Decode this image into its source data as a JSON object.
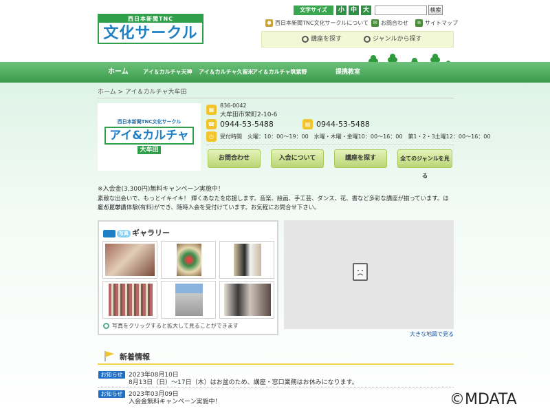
{
  "header": {
    "logo_top": "西日本新聞TNC",
    "logo_main": "文化サークル",
    "font_size_label": "文字サイズ",
    "font_sizes": [
      "小",
      "中",
      "大"
    ],
    "search_placeholder": "",
    "search_button": "検索",
    "top_links": [
      "西日本新聞TNC文化サークルについて",
      "お問合わせ",
      "サイトマップ"
    ],
    "search_course": "講座を探す",
    "search_genre": "ジャンルから探す"
  },
  "nav": [
    "ホーム",
    "アイ＆カルチャ天神",
    "アイ＆カルチャ久留米",
    "アイ＆カルチャ筑紫野",
    "提携教室"
  ],
  "breadcrumb": "ホーム > アイ＆カルチャ大牟田",
  "shop": {
    "logo_sub": "西日本新聞TNC文化サークル",
    "logo_name": "アイ&カルチャ",
    "logo_place": "大牟田",
    "postal": "836-0042",
    "address": "大牟田市栄町2-10-6",
    "tel": "0944-53-5488",
    "fax": "0944-53-5488",
    "hours": "受付時間　火曜：10：00～19：00　水曜・木曜・金曜10：00～16：00　第1・2・3土曜12：00～16：00"
  },
  "actions": [
    "お問合わせ",
    "入会について",
    "講座を探す",
    "全てのジャンルを見る"
  ],
  "description": {
    "campaign": "※入会金(3,300円)無料キャンペーン実施中！",
    "line1": "素敵な出会いで、もっとイキイキ！ 輝くあなたを応援します。音楽、絵画、手工芸、ダンス、花、書など多彩な講座が揃っています。ほとんどの講",
    "line2": "座が見学、体験(有料)ができ、随時入会を受付けています。お気軽にお問合せ下さい。"
  },
  "gallery": {
    "title_pill": "写真",
    "title": "ギャラリー",
    "caption": "写真をクリックすると拡大して見ることができます"
  },
  "map": {
    "link": "大きな地図で見る"
  },
  "news": {
    "title": "新着情報",
    "items": [
      {
        "badge": "お知らせ",
        "date": "2023年08月10日",
        "text": "8月13日（日）～17日（木）はお盆のため、講座・窓口業務はお休みになります。"
      },
      {
        "badge": "お知らせ",
        "date": "2023年03月09日",
        "text": "入会金無料キャンペーン実施中！"
      }
    ]
  },
  "watermark": "©MDATA",
  "colors": {
    "green": "#3aa64f",
    "blue": "#1e7fc4",
    "yellow": "#f0c42a"
  }
}
